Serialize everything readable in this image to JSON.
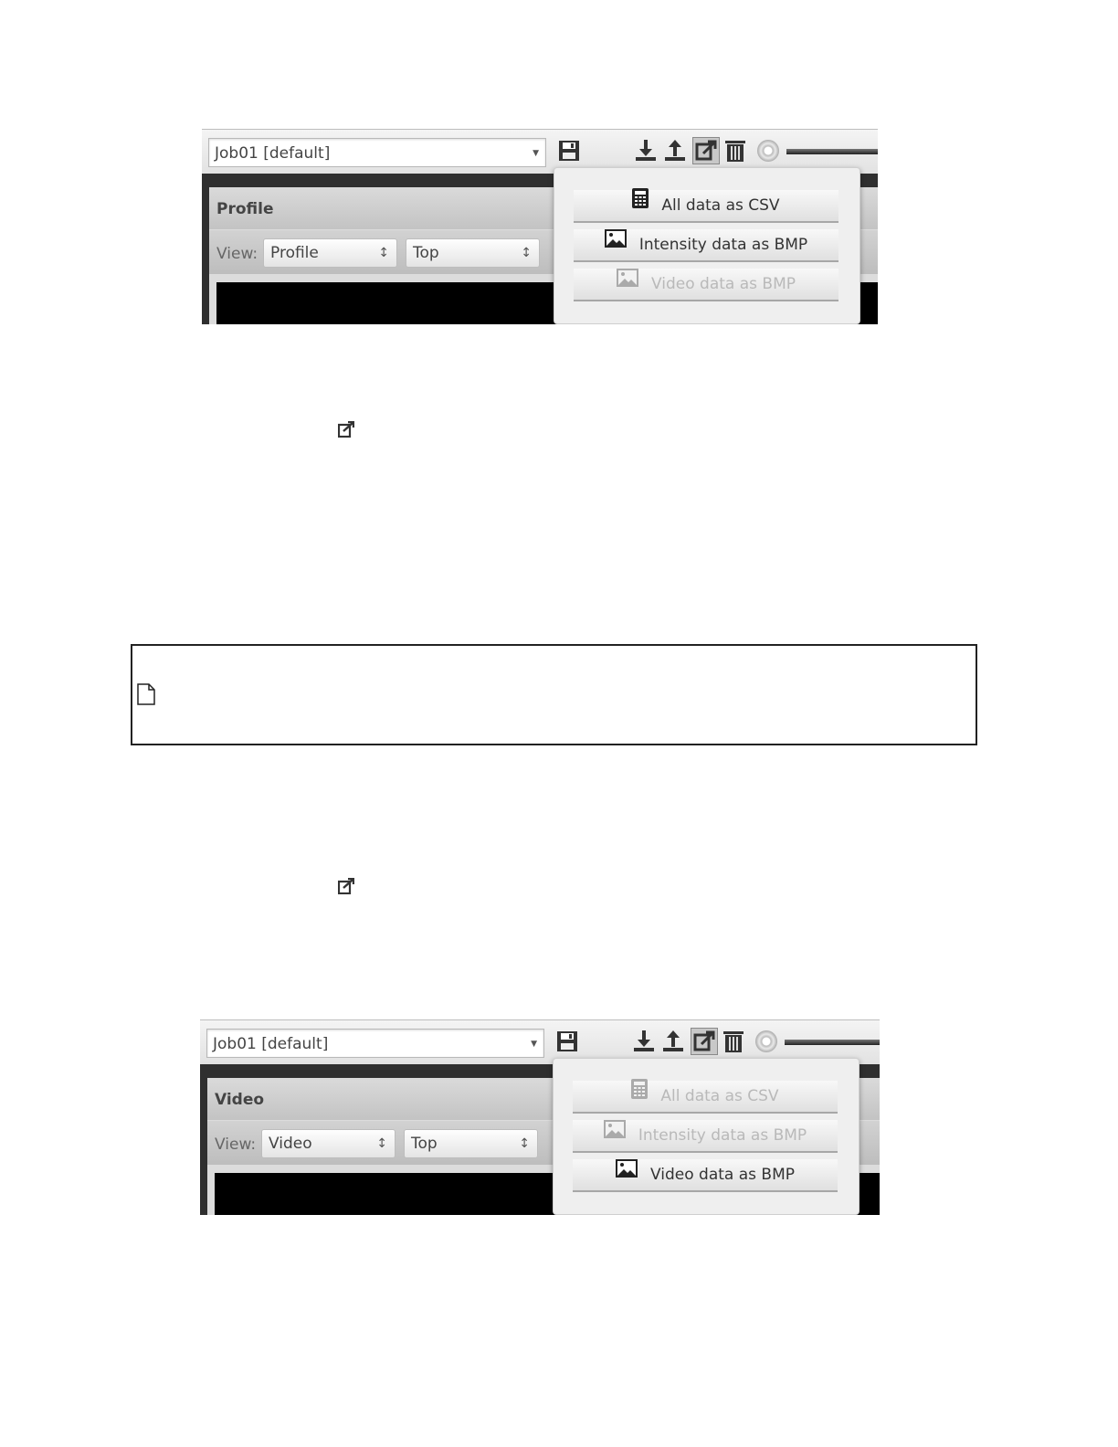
{
  "screenshots": [
    {
      "job_select": "Job01 [default]",
      "panel_title": "Profile",
      "view_label": "View:",
      "view_select": "Profile",
      "orient_select": "Top",
      "popup": [
        {
          "label": "All data as CSV",
          "icon": "calculator-icon",
          "enabled": true
        },
        {
          "label": "Intensity data as BMP",
          "icon": "image-icon",
          "enabled": true
        },
        {
          "label": "Video data as BMP",
          "icon": "image-icon",
          "enabled": false
        }
      ]
    },
    {
      "job_select": "Job01 [default]",
      "panel_title": "Video",
      "view_label": "View:",
      "view_select": "Video",
      "orient_select": "Top",
      "popup": [
        {
          "label": "All data as CSV",
          "icon": "calculator-icon",
          "enabled": false
        },
        {
          "label": "Intensity data as BMP",
          "icon": "image-icon",
          "enabled": false
        },
        {
          "label": "Video data as BMP",
          "icon": "image-icon",
          "enabled": true
        }
      ]
    }
  ],
  "icons": {
    "toolbar": [
      "save-icon",
      "download-icon",
      "upload-icon",
      "export-icon",
      "trash-icon",
      "slider-knob"
    ],
    "inline": "external-link-icon",
    "note": "document-icon"
  }
}
